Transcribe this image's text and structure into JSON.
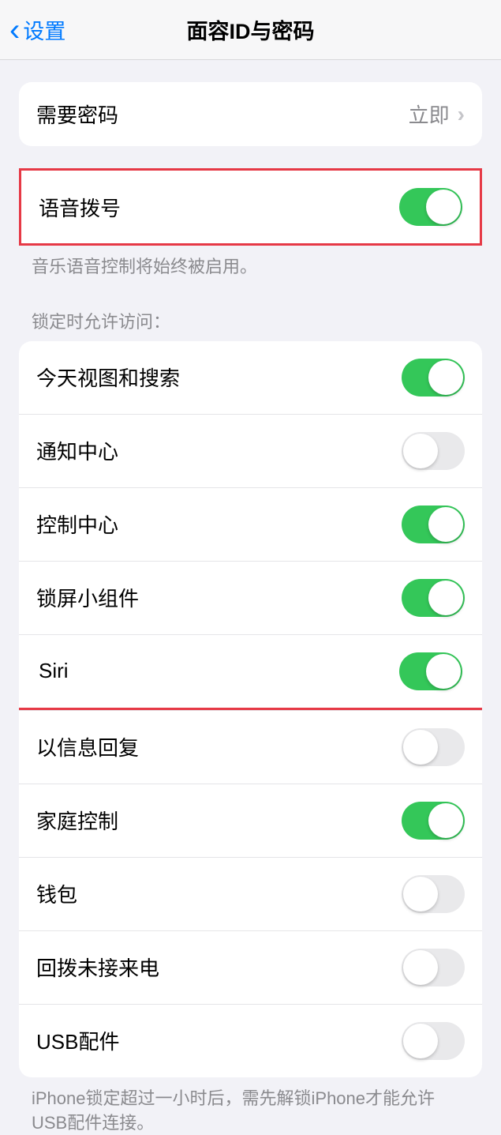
{
  "nav": {
    "back_label": "设置",
    "title": "面容ID与密码"
  },
  "require_passcode": {
    "label": "需要密码",
    "value": "立即"
  },
  "voice_dial": {
    "label": "语音拨号",
    "footer": "音乐语音控制将始终被启用。"
  },
  "lock_section_header": "锁定时允许访问：",
  "lock_items": [
    {
      "label": "今天视图和搜索",
      "on": true
    },
    {
      "label": "通知中心",
      "on": false
    },
    {
      "label": "控制中心",
      "on": true
    },
    {
      "label": "锁屏小组件",
      "on": true
    },
    {
      "label": "Siri",
      "on": true
    },
    {
      "label": "以信息回复",
      "on": false
    },
    {
      "label": "家庭控制",
      "on": true
    },
    {
      "label": "钱包",
      "on": false
    },
    {
      "label": "回拨未接来电",
      "on": false
    },
    {
      "label": "USB配件",
      "on": false
    }
  ],
  "usb_footer": "iPhone锁定超过一小时后，需先解锁iPhone才能允许USB配件连接。"
}
